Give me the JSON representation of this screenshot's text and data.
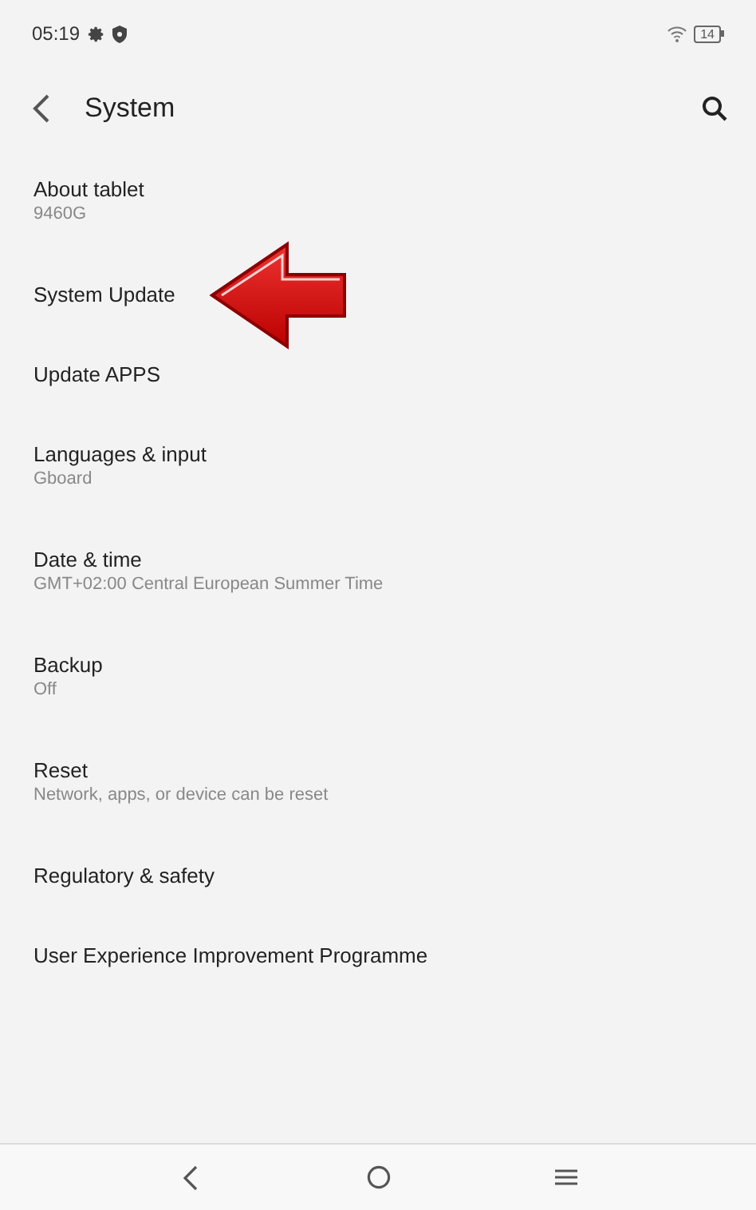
{
  "status_bar": {
    "time": "05:19",
    "battery": "14"
  },
  "header": {
    "title": "System"
  },
  "items": [
    {
      "title": "About tablet",
      "subtitle": "9460G"
    },
    {
      "title": "System Update"
    },
    {
      "title": "Update APPS"
    },
    {
      "title": "Languages & input",
      "subtitle": "Gboard"
    },
    {
      "title": "Date & time",
      "subtitle": "GMT+02:00 Central European Summer Time"
    },
    {
      "title": "Backup",
      "subtitle": "Off"
    },
    {
      "title": "Reset",
      "subtitle": "Network, apps, or device can be reset"
    },
    {
      "title": "Regulatory & safety"
    },
    {
      "title": "User Experience Improvement Programme"
    }
  ]
}
